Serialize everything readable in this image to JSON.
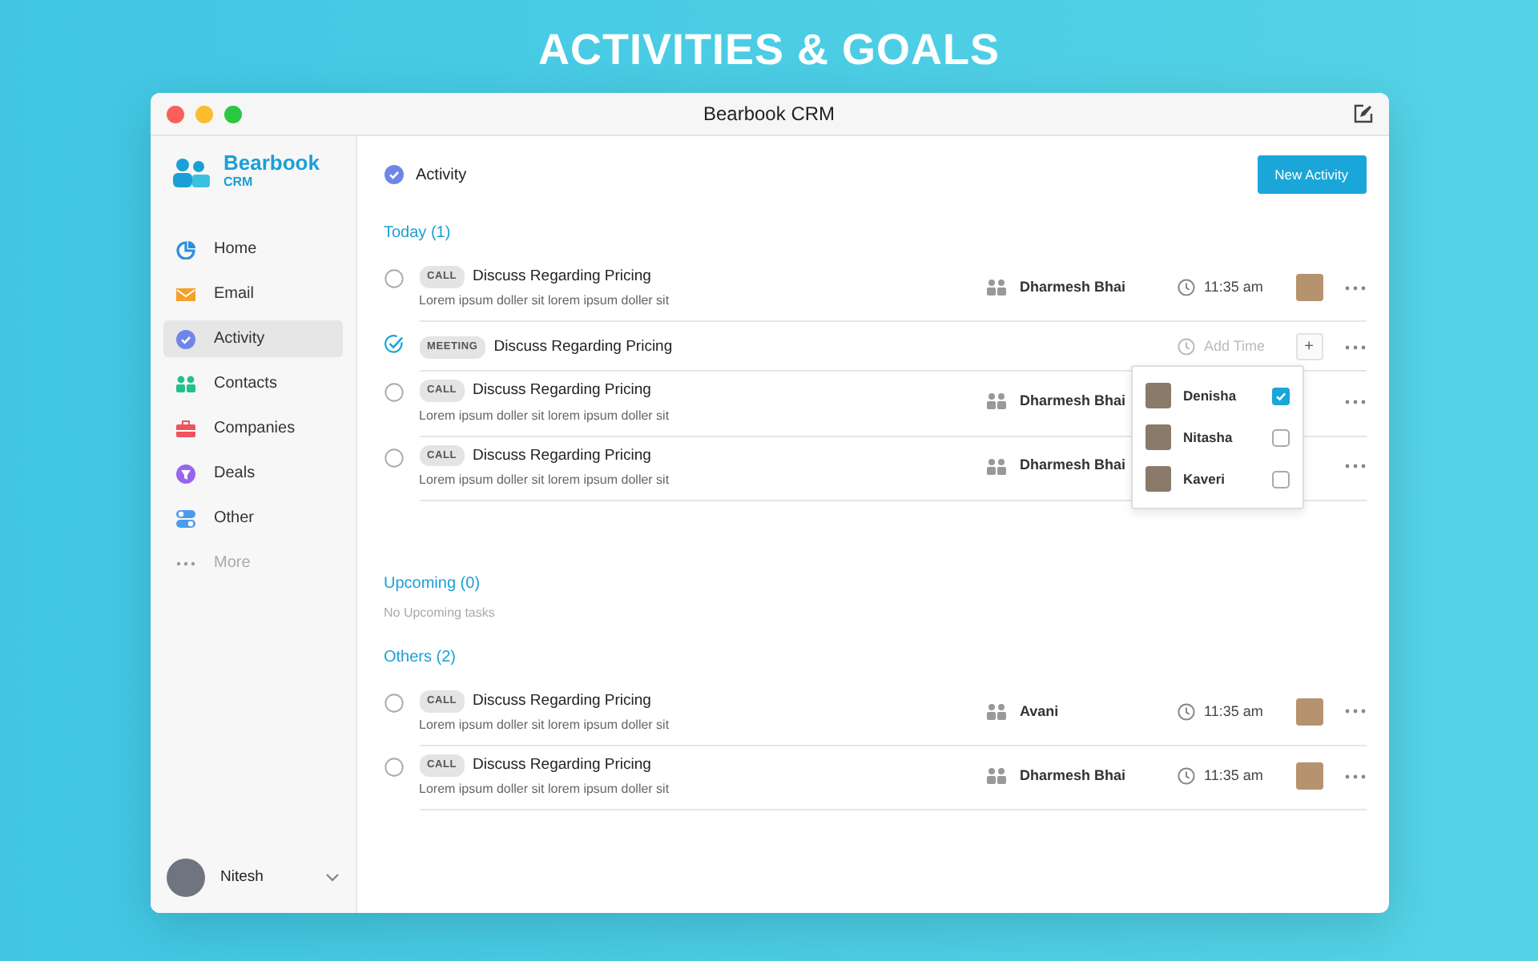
{
  "headline": "ACTIVITIES & GOALS",
  "window": {
    "title": "Bearbook CRM"
  },
  "sidebar": {
    "brand": {
      "name": "Bearbook",
      "sub": "CRM"
    },
    "items": [
      {
        "kind": "home",
        "label": "Home",
        "selected": false,
        "disabled": false
      },
      {
        "kind": "email",
        "label": "Email",
        "selected": false,
        "disabled": false
      },
      {
        "kind": "activity",
        "label": "Activity",
        "selected": true,
        "disabled": false
      },
      {
        "kind": "contacts",
        "label": "Contacts",
        "selected": false,
        "disabled": false
      },
      {
        "kind": "companies",
        "label": "Companies",
        "selected": false,
        "disabled": false
      },
      {
        "kind": "deals",
        "label": "Deals",
        "selected": false,
        "disabled": false
      },
      {
        "kind": "other",
        "label": "Other",
        "selected": false,
        "disabled": false
      },
      {
        "kind": "more",
        "label": "More",
        "selected": false,
        "disabled": true
      }
    ],
    "user": {
      "name": "Nitesh"
    }
  },
  "header": {
    "title": "Activity",
    "button": "New Activity"
  },
  "sections": [
    {
      "title": "Today (1)",
      "tasks": [
        {
          "tag": "CALL",
          "title": "Discuss Regarding Pricing",
          "description": "Lorem ipsum doller sit lorem ipsum doller sit",
          "done": false,
          "contact": "Dharmesh Bhai",
          "time": "11:35 am"
        },
        {
          "tag": "MEETING",
          "title": "Discuss Regarding Pricing",
          "done": true,
          "time_placeholder": "Add Time",
          "add_button": "+",
          "assignee_menu": {
            "options": [
              {
                "name": "Denisha",
                "checked": true
              },
              {
                "name": "Nitasha",
                "checked": false
              },
              {
                "name": "Kaveri",
                "checked": false
              }
            ]
          }
        },
        {
          "tag": "CALL",
          "title": "Discuss Regarding Pricing",
          "description": "Lorem ipsum doller sit lorem ipsum doller sit",
          "done": false,
          "contact": "Dharmesh Bhai"
        },
        {
          "tag": "CALL",
          "title": "Discuss Regarding Pricing",
          "description": "Lorem ipsum doller sit lorem ipsum doller sit",
          "done": false,
          "contact": "Dharmesh Bhai"
        }
      ]
    },
    {
      "title": "Upcoming (0)",
      "empty_text": "No Upcoming tasks"
    },
    {
      "title": "Others (2)",
      "tasks": [
        {
          "tag": "CALL",
          "title": "Discuss Regarding Pricing",
          "description": "Lorem ipsum doller sit lorem ipsum doller sit",
          "done": false,
          "contact": "Avani",
          "time": "11:35 am"
        },
        {
          "tag": "CALL",
          "title": "Discuss Regarding Pricing",
          "description": "Lorem ipsum doller sit lorem ipsum doller sit",
          "done": false,
          "contact": "Dharmesh Bhai",
          "time": "11:35 am"
        }
      ]
    }
  ]
}
